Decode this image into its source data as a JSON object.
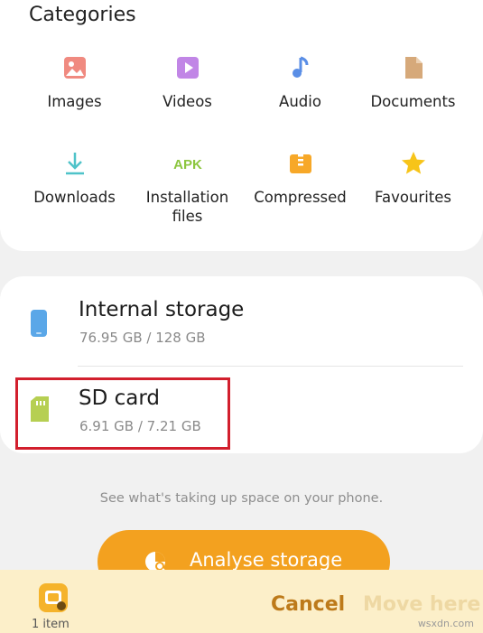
{
  "categories": {
    "title": "Categories",
    "items": [
      {
        "label": "Images",
        "icon": "images-icon"
      },
      {
        "label": "Videos",
        "icon": "videos-icon"
      },
      {
        "label": "Audio",
        "icon": "audio-icon"
      },
      {
        "label": "Documents",
        "icon": "documents-icon"
      },
      {
        "label": "Downloads",
        "icon": "downloads-icon"
      },
      {
        "label": "Installation files",
        "icon": "apk-icon",
        "icon_text": "APK"
      },
      {
        "label": "Compressed",
        "icon": "compressed-icon"
      },
      {
        "label": "Favourites",
        "icon": "star-icon"
      }
    ]
  },
  "storage": {
    "internal": {
      "name": "Internal storage",
      "size": "76.95 GB / 128 GB"
    },
    "sd_card": {
      "name": "SD card",
      "size": "6.91 GB / 7.21 GB"
    }
  },
  "hint": "See what's taking up space on your phone.",
  "analyse_button": {
    "label": "Analyse storage"
  },
  "bottom_bar": {
    "count": "1 item",
    "cancel_label": "Cancel",
    "move_label": "Move here"
  },
  "watermark": "wsxdn.com",
  "colors": {
    "accent": "#f3a11f",
    "highlight": "#d21f2d",
    "bottom_bar": "#fcefc9",
    "cancel": "#bd7a1a"
  }
}
